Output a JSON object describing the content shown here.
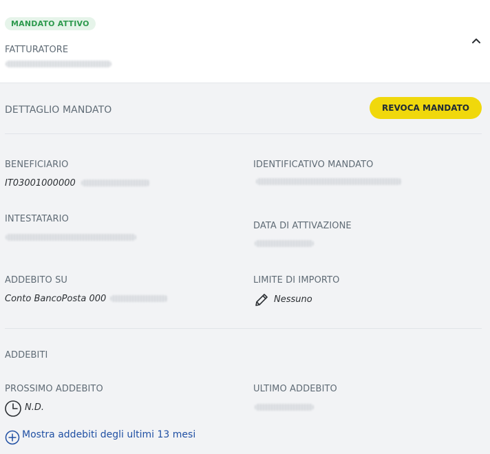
{
  "header": {
    "status_badge": "MANDATO ATTIVO",
    "fatturatore_label": "FATTURATORE"
  },
  "detail": {
    "title": "DETTAGLIO MANDATO",
    "revoke_button": "REVOCA MANDATO",
    "beneficiario_label": "BENEFICIARIO",
    "beneficiario_value": "IT03001000000",
    "identificativo_label": "IDENTIFICATIVO MANDATO",
    "intestatario_label": "INTESTATARIO",
    "data_attivazione_label": "DATA DI ATTIVAZIONE",
    "addebito_su_label": "ADDEBITO SU",
    "addebito_su_value": "Conto BancoPosta 000",
    "limite_label": "LIMITE DI IMPORTO",
    "limite_value": "Nessuno"
  },
  "addebiti": {
    "title": "ADDEBITI",
    "prossimo_label": "PROSSIMO ADDEBITO",
    "prossimo_value": "N.D.",
    "ultimo_label": "ULTIMO ADDEBITO",
    "link_label": "Mostra addebiti degli ultimi 13 mesi"
  },
  "colors": {
    "accent_yellow": "#f0d80c",
    "badge_green": "#2e9a4e",
    "link_blue": "#1f4fa3"
  },
  "icons": [
    "chevron-up-icon",
    "pencil-icon",
    "clock-icon",
    "plus-circle-icon"
  ]
}
